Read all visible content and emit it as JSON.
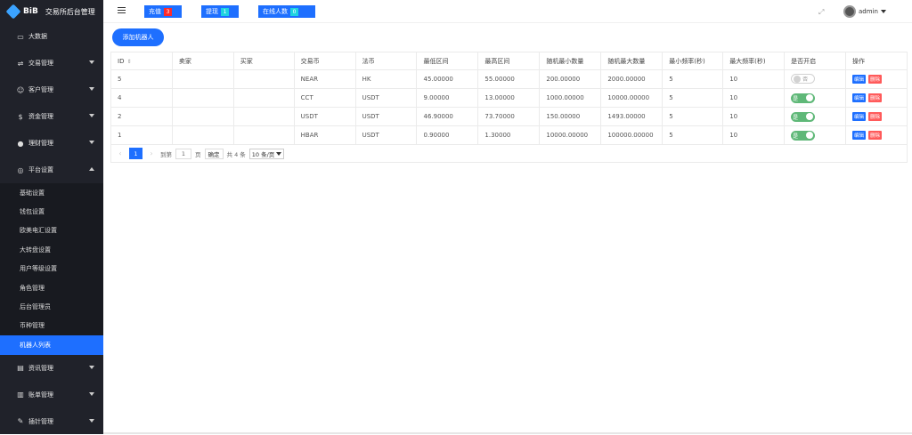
{
  "brand": {
    "logo_text": "BiB",
    "title": "交易所后台管理"
  },
  "sidebar": {
    "items": [
      {
        "label": "大数据",
        "icon": "monitor-icon",
        "arrow": false
      },
      {
        "label": "交易管理",
        "icon": "exchange-icon",
        "arrow": true
      },
      {
        "label": "客户管理",
        "icon": "users-icon",
        "arrow": true
      },
      {
        "label": "资金管理",
        "icon": "money-icon",
        "arrow": true
      },
      {
        "label": "理财管理",
        "icon": "piggy-icon",
        "arrow": true
      },
      {
        "label": "平台设置",
        "icon": "settings-icon",
        "arrow": true,
        "expanded": true
      }
    ],
    "submenu": [
      {
        "label": "基础设置"
      },
      {
        "label": "钱包设置"
      },
      {
        "label": "欧美电汇设置"
      },
      {
        "label": "大转盘设置"
      },
      {
        "label": "用户等级设置"
      },
      {
        "label": "角色管理"
      },
      {
        "label": "后台管理员"
      },
      {
        "label": "币种管理"
      },
      {
        "label": "机器人列表",
        "active": true
      }
    ],
    "items_after": [
      {
        "label": "资讯管理",
        "icon": "news-icon"
      },
      {
        "label": "账单管理",
        "icon": "bill-icon"
      },
      {
        "label": "插针管理",
        "icon": "needle-icon"
      }
    ]
  },
  "topbar": {
    "recharge_label": "充值",
    "recharge_count": "3",
    "withdraw_label": "提现",
    "withdraw_count": "1",
    "online_label": "在线人数",
    "online_count": "0",
    "user_name": "admin"
  },
  "main": {
    "add_button": "添加机器人",
    "columns": [
      "ID",
      "卖家",
      "买家",
      "交易币",
      "法币",
      "最低区间",
      "最高区间",
      "随机最小数量",
      "随机最大数量",
      "最小频率(秒)",
      "最大频率(秒)",
      "是否开启",
      "操作"
    ],
    "rows": [
      {
        "id": "5",
        "seller": "",
        "buyer": "",
        "coin": "NEAR",
        "fiat": "HK",
        "min": "45.00000",
        "max": "55.00000",
        "rmin": "200.00000",
        "rmax": "2000.00000",
        "fmin": "5",
        "fmax": "10",
        "enabled": false
      },
      {
        "id": "4",
        "seller": "",
        "buyer": "",
        "coin": "CCT",
        "fiat": "USDT",
        "min": "9.00000",
        "max": "13.00000",
        "rmin": "1000.00000",
        "rmax": "10000.00000",
        "fmin": "5",
        "fmax": "10",
        "enabled": true
      },
      {
        "id": "2",
        "seller": "",
        "buyer": "",
        "coin": "USDT",
        "fiat": "USDT",
        "min": "46.90000",
        "max": "73.70000",
        "rmin": "150.00000",
        "rmax": "1493.00000",
        "fmin": "5",
        "fmax": "10",
        "enabled": true
      },
      {
        "id": "1",
        "seller": "",
        "buyer": "",
        "coin": "HBAR",
        "fiat": "USDT",
        "min": "0.90000",
        "max": "1.30000",
        "rmin": "10000.00000",
        "rmax": "100000.00000",
        "fmin": "5",
        "fmax": "10",
        "enabled": true
      }
    ],
    "toggle_on": "是",
    "toggle_off": "否",
    "edit_label": "编辑",
    "delete_label": "删除"
  },
  "pager": {
    "current": "1",
    "goto_label": "到第",
    "goto_value": "1",
    "page_unit": "页",
    "confirm": "确定",
    "total": "共 4 条",
    "page_size": "10 条/页"
  }
}
